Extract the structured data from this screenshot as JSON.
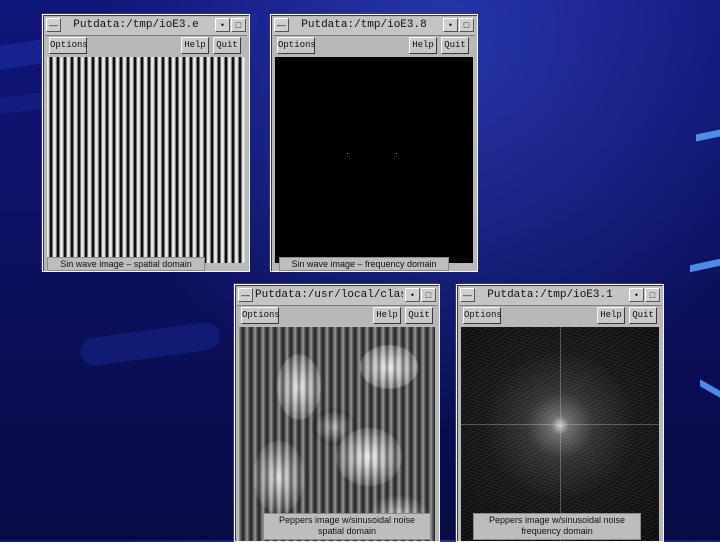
{
  "windows": {
    "w1": {
      "title": "Putdata:/tmp/ioE3.e",
      "options": "Options",
      "help": "Help",
      "quit": "Quit",
      "caption": "Sin wave image – spatial domain"
    },
    "w2": {
      "title": "Putdata:/tmp/ioE3.8",
      "options": "Options",
      "help": "Help",
      "quit": "Quit",
      "caption": "Sin wave image – frequency domain",
      "coord": "163"
    },
    "w3": {
      "title": "Putdata:/usr/local/classes/c",
      "options": "Options",
      "help": "Help",
      "quit": "Quit",
      "caption1": "Peppers image w/sinusoidal noise",
      "caption2": "spatial domain"
    },
    "w4": {
      "title": "Putdata:/tmp/ioE3.1",
      "options": "Options",
      "help": "Help",
      "quit": "Quit",
      "caption1": "Peppers image w/sinusoidal noise",
      "caption2": "frequency domain"
    }
  },
  "window_controls": {
    "menu_glyph": "—",
    "minimize_glyph": "•",
    "maximize_glyph": "□"
  }
}
